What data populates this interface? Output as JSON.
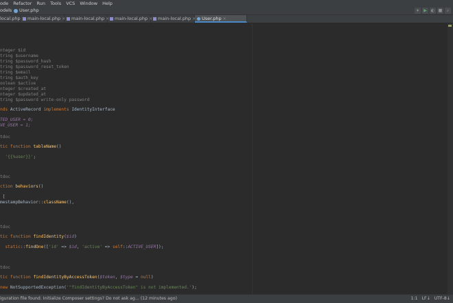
{
  "menu": {
    "items": [
      "ode",
      "Refactor",
      "Run",
      "Tools",
      "VCS",
      "Window",
      "Help"
    ]
  },
  "navbar": {
    "crumb_left": "odels",
    "crumb_file": "User.php"
  },
  "tabs": [
    {
      "label": "local.php"
    },
    {
      "label": "main-local.php"
    },
    {
      "label": "main-local.php"
    },
    {
      "label": "main-local.php"
    },
    {
      "label": "main-local.php"
    },
    {
      "label": "User.php",
      "active": true
    }
  ],
  "code": {
    "l1": "nteger $id",
    "l2": "tring $username",
    "l3": "tring $password_hash",
    "l4": "tring $password_reset_token",
    "l5": "tring $email",
    "l6": "tring $auth_key",
    "l7": "oolean $active",
    "l8": "nteger $created_at",
    "l9": "nteger $updated_at",
    "l10": "tring $password write-only password",
    "l11_kw1": "nds ",
    "l11_cls": "ActiveRecord ",
    "l11_kw2": "implements ",
    "l11_iface": "IdentityInterface",
    "l12": "TED_USER = 0;",
    "l13": "VE_USER = 1;",
    "l14": "tdoc",
    "l15_kw": "tic function ",
    "l15_fn": "tableName",
    "l15_rest": "()",
    "l16_str": "'{{%user}}'",
    "l16_rest": ";",
    "l17": "tdoc",
    "l18_kw": "ction ",
    "l18_fn": "behaviors",
    "l18_rest": "()",
    "l19": " [",
    "l20_cls": "mestampBehavior",
    "l20_op": "::",
    "l20_fn": "className",
    "l20_rest": "(),",
    "l21": "tdoc",
    "l22_kw": "tic function ",
    "l22_fn": "findIdentity",
    "l22_open": "(",
    "l22_var": "$id",
    "l22_close": ")",
    "l23_kw": "static",
    "l23_op": "::",
    "l23_fn": "findOne",
    "l23_a": "([",
    "l23_s1": "'id'",
    "l23_b": " => ",
    "l23_v": "$id",
    "l23_c": ", ",
    "l23_s2": "'active'",
    "l23_d": " => ",
    "l23_self": "self",
    "l23_e": "::",
    "l23_cst": "ACTIVE_USER",
    "l23_f": "]);",
    "l24": "tdoc",
    "l25_kw": "tic function ",
    "l25_fn": "findIdentityByAccessToken",
    "l25_open": "(",
    "l25_v1": "$token",
    "l25_sep": ", ",
    "l25_v2": "$type",
    "l25_eq": " = ",
    "l25_null": "null",
    "l25_close": ")",
    "l26_kw": "new ",
    "l26_cls": "NotSupportedException",
    "l26_a": "(",
    "l26_str": "'\"findIdentityByAccessToken\" is not implemented.'",
    "l26_b": ");"
  },
  "status": {
    "message": "iguration file found. Initialize Composer settings? Do not ask ag... (12 minutes ago)",
    "position": "1:1",
    "line_sep": "LF↓",
    "encoding": "UTF-8↓"
  },
  "colors": {
    "background": "#2b2b2b",
    "keyword": "#cc7832",
    "function": "#ffc66d",
    "string": "#6a8759",
    "comment": "#808080",
    "variable": "#9876aa"
  },
  "icons": [
    "php-file-icon",
    "close-icon",
    "run-icon",
    "debug-icon",
    "stop-icon"
  ]
}
